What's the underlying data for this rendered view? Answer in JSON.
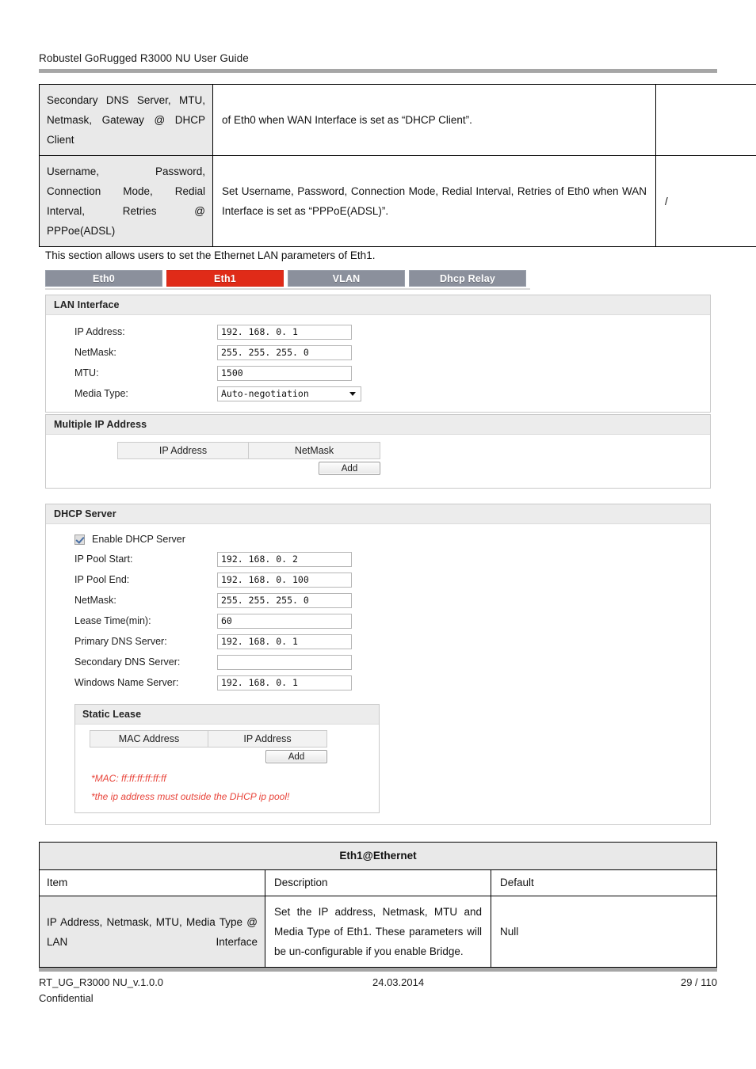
{
  "header": {
    "title": "Robustel GoRugged R3000 NU User Guide"
  },
  "table_top": {
    "rows": [
      {
        "item": "Secondary DNS Server, MTU, Netmask, Gateway @ DHCP Client",
        "description": "of Eth0 when WAN Interface is set as “DHCP Client”.",
        "default": ""
      },
      {
        "item": "Username, Password, Connection Mode, Redial Interval, Retries @ PPPoe(ADSL)",
        "description": "Set Username, Password, Connection Mode, Redial Interval, Retries of Eth0 when WAN Interface is set as “PPPoE(ADSL)”.",
        "default": "/"
      }
    ]
  },
  "paragraph": "This section allows users to set the Ethernet LAN parameters of Eth1.",
  "webui": {
    "tabs": [
      {
        "label": "Eth0",
        "active": false
      },
      {
        "label": "Eth1",
        "active": true
      },
      {
        "label": "VLAN",
        "active": false
      },
      {
        "label": "Dhcp Relay",
        "active": false
      }
    ],
    "lan_interface": {
      "title": "LAN Interface",
      "fields": [
        {
          "label": "IP Address:",
          "value": "192. 168. 0. 1"
        },
        {
          "label": "NetMask:",
          "value": "255. 255. 255. 0"
        },
        {
          "label": "MTU:",
          "value": "1500"
        }
      ],
      "media_type": {
        "label": "Media Type:",
        "value": "Auto-negotiation"
      }
    },
    "multiple_ip": {
      "title": "Multiple IP Address",
      "columns": [
        "IP Address",
        "NetMask"
      ],
      "add_label": "Add"
    },
    "dhcp_server": {
      "title": "DHCP Server",
      "enable_label": "Enable DHCP Server",
      "enable_checked": true,
      "fields": [
        {
          "label": "IP Pool Start:",
          "value": "192. 168. 0. 2"
        },
        {
          "label": "IP Pool End:",
          "value": "192. 168. 0. 100"
        },
        {
          "label": "NetMask:",
          "value": "255. 255. 255. 0"
        },
        {
          "label": "Lease Time(min):",
          "value": "60"
        },
        {
          "label": "Primary DNS Server:",
          "value": "192. 168. 0. 1"
        },
        {
          "label": "Secondary DNS Server:",
          "value": ""
        },
        {
          "label": "Windows Name Server:",
          "value": "192. 168. 0. 1"
        }
      ],
      "static_lease": {
        "title": "Static Lease",
        "columns": [
          "MAC Address",
          "IP Address"
        ],
        "add_label": "Add",
        "hints": [
          "*MAC: ff:ff:ff:ff:ff:ff",
          "*the ip address must outside the DHCP ip pool!"
        ]
      }
    }
  },
  "table_bottom": {
    "title": "Eth1@Ethernet",
    "columns": [
      "Item",
      "Description",
      "Default"
    ],
    "rows": [
      {
        "item": "IP Address, Netmask, MTU, Media Type @ LAN Interface",
        "description": "Set the IP address, Netmask, MTU and Media Type of Eth1. These parameters will be un-configurable if you enable Bridge.",
        "default": "Null"
      }
    ]
  },
  "footer": {
    "doc_id": "RT_UG_R3000 NU_v.1.0.0",
    "date": "24.03.2014",
    "page": "29 / 110",
    "confidential": "Confidential"
  },
  "colors": {
    "accent_red": "#e02b18",
    "tab_gray": "#8b909c",
    "rule_gray": "#a6a6a6",
    "hint_red": "#e8443a"
  }
}
